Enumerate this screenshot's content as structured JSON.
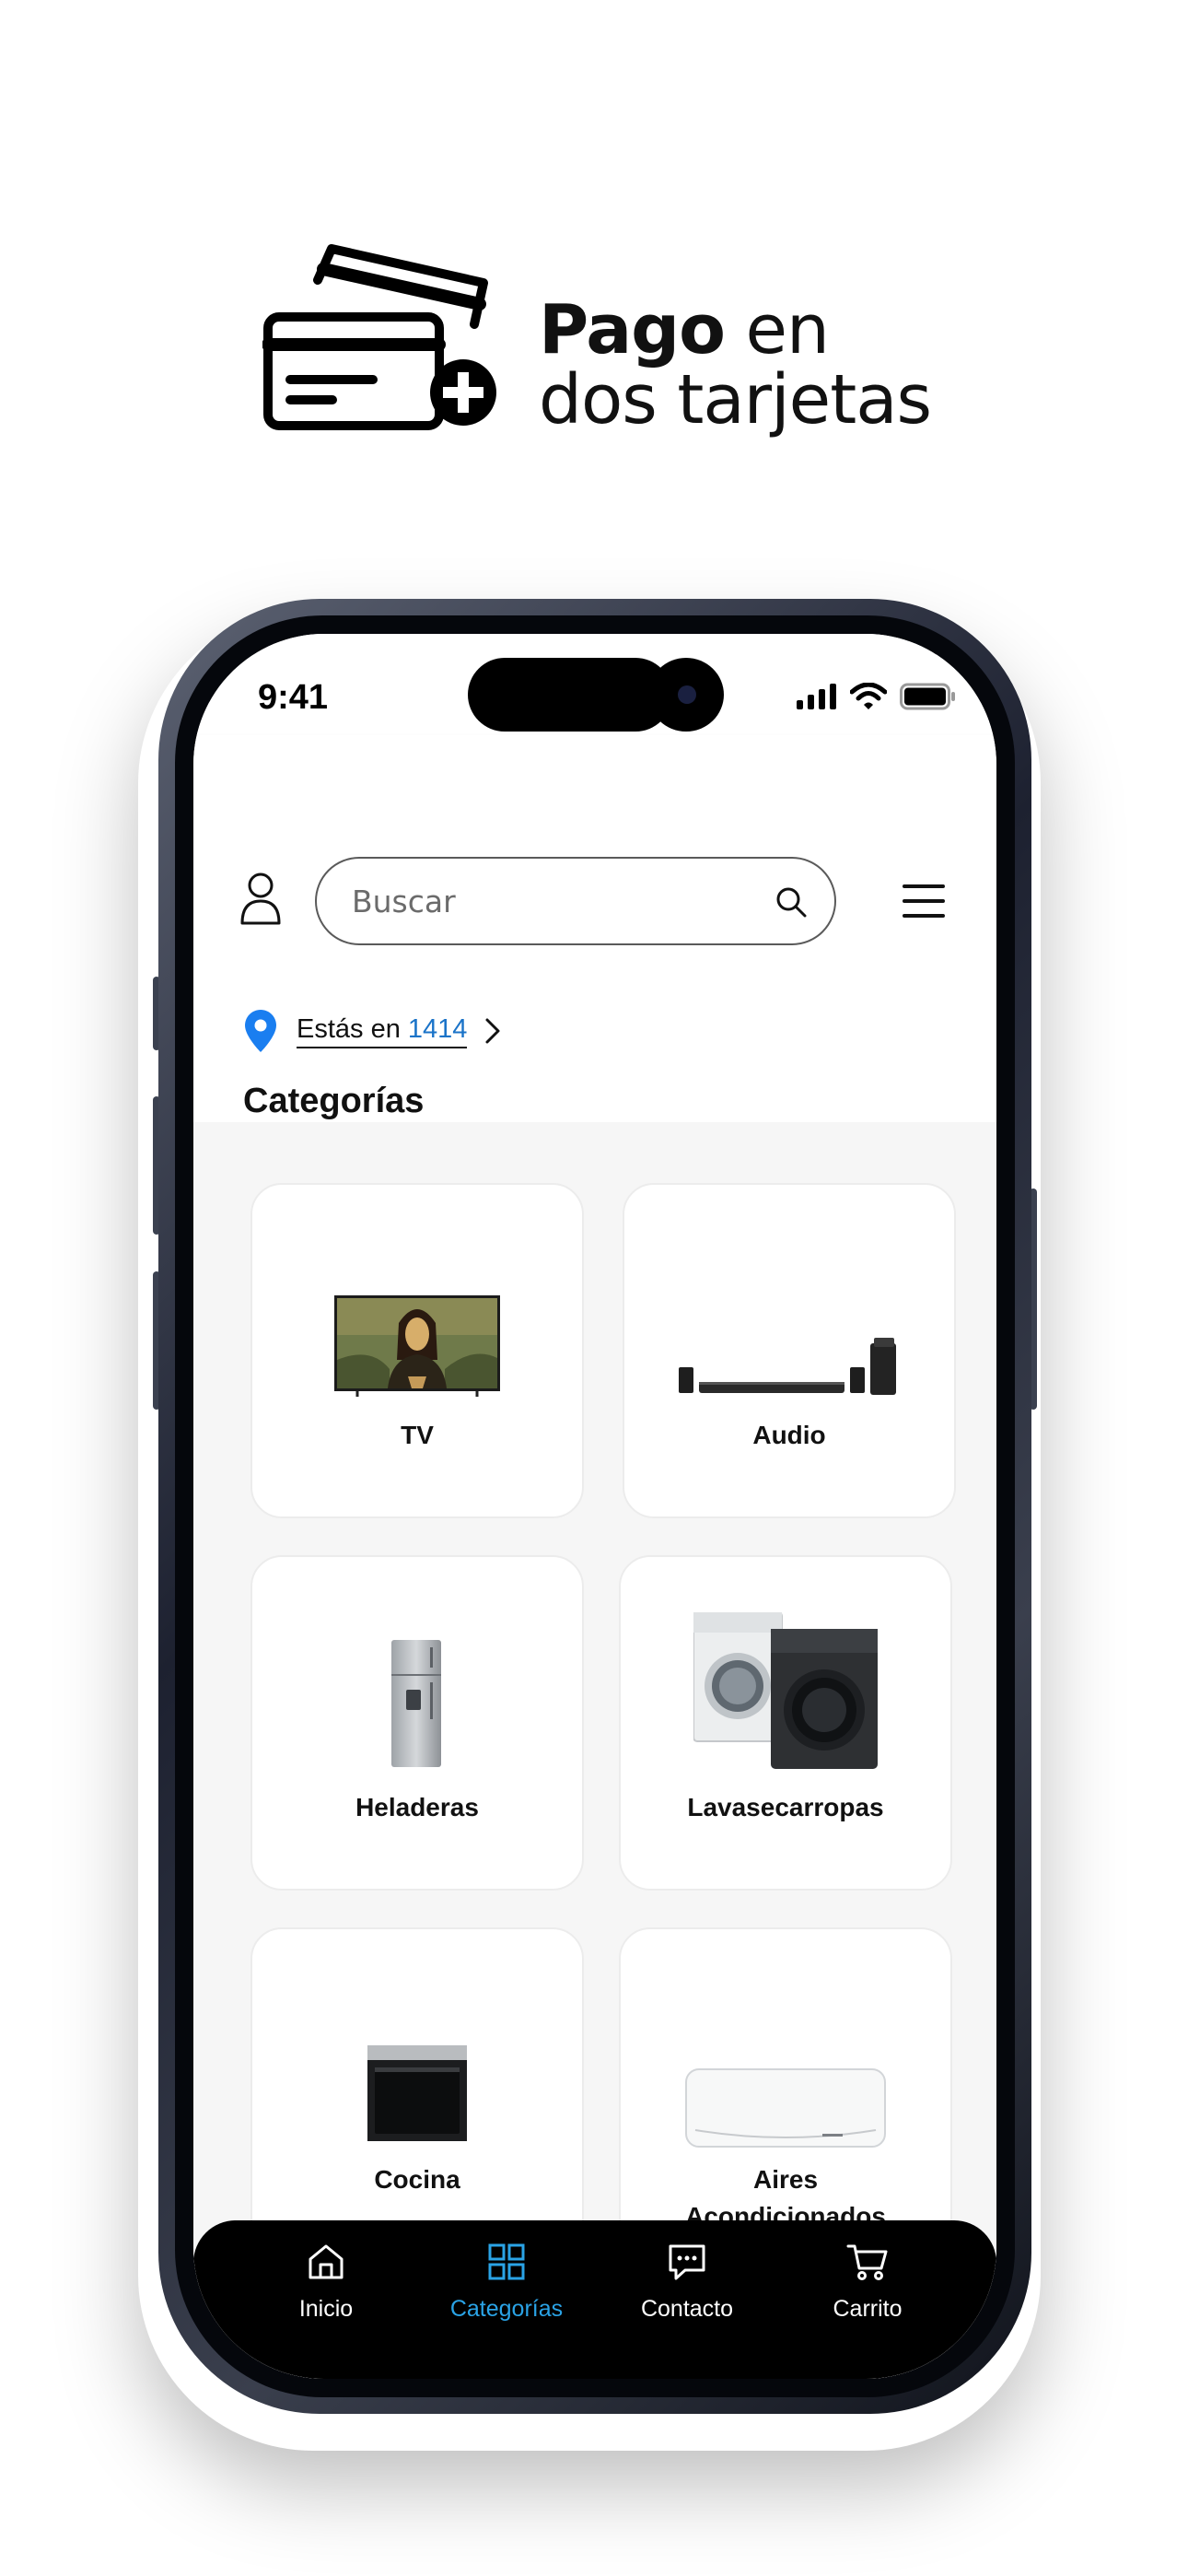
{
  "promo": {
    "title_bold": "Pago",
    "title_rest": " en",
    "title_line2": "dos tarjetas",
    "icon": "credit-cards-plus-icon"
  },
  "status_bar": {
    "time": "9:41",
    "icons": [
      "signal-icon",
      "wifi-icon",
      "battery-icon"
    ]
  },
  "header": {
    "search_placeholder": "Buscar",
    "location_prefix": "Estás en ",
    "location_code": "1414",
    "section_title": "Categorías"
  },
  "categories": [
    {
      "label": "TV",
      "icon": "tv-image"
    },
    {
      "label": "Audio",
      "icon": "soundbar-image"
    },
    {
      "label": "Heladeras",
      "icon": "refrigerator-image"
    },
    {
      "label": "Lavasecarropas",
      "icon": "washer-dryer-image"
    },
    {
      "label": "Cocina",
      "icon": "oven-image"
    },
    {
      "label": "Aires Acondicionados",
      "icon": "air-conditioner-image"
    }
  ],
  "nav": {
    "items": [
      {
        "label": "Inicio",
        "icon": "home-icon"
      },
      {
        "label": "Categorías",
        "icon": "grid-icon"
      },
      {
        "label": "Contacto",
        "icon": "chat-icon"
      },
      {
        "label": "Carrito",
        "icon": "cart-icon"
      }
    ],
    "active_color": "#2aa3e6"
  },
  "colors": {
    "link_blue": "#1a73c8",
    "pin_blue": "#1a7ef0"
  }
}
